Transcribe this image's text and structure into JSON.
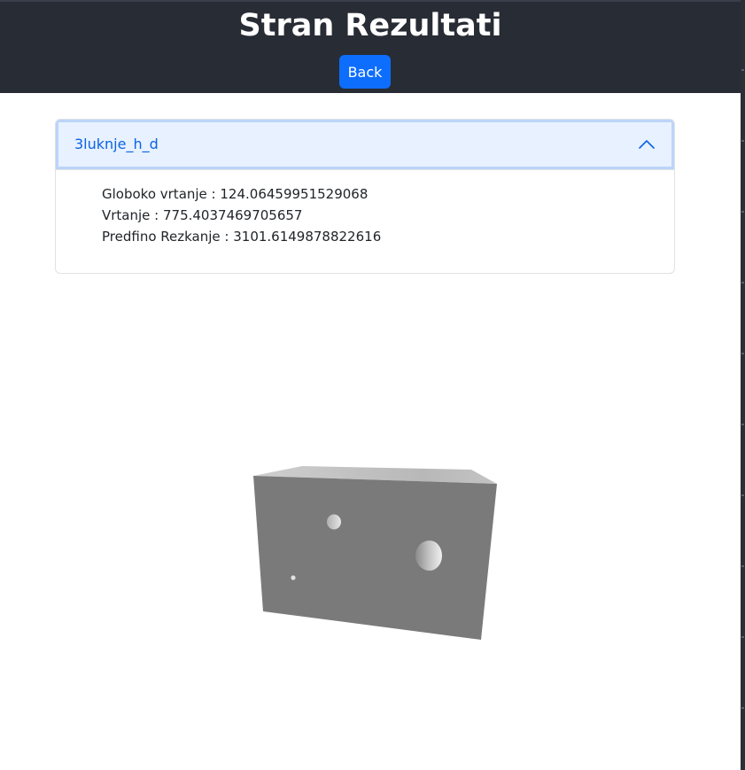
{
  "header": {
    "title": "Stran Rezultati",
    "back_label": "Back"
  },
  "accordion": {
    "title": "3luknje_h_d",
    "expanded": true,
    "results": [
      {
        "label": "Globoko vrtanje",
        "value": "124.06459951529068"
      },
      {
        "label": "Vrtanje",
        "value": "775.4037469705657"
      },
      {
        "label": "Predfino Rezkanje",
        "value": "3101.6149878822616"
      }
    ],
    "results_text": [
      "Globoko vrtanje : 124.06459951529068",
      "Vrtanje : 775.4037469705657",
      "Predfino Rezkanje : 3101.6149878822616"
    ]
  },
  "viewer": {
    "model": "box-with-three-holes",
    "model_color": "#7a7a7a"
  },
  "colors": {
    "header_bg": "#282c34",
    "button_bg": "#0d6efd",
    "accordion_header_bg": "#e7f1ff",
    "accordion_title": "#0c63e4"
  }
}
